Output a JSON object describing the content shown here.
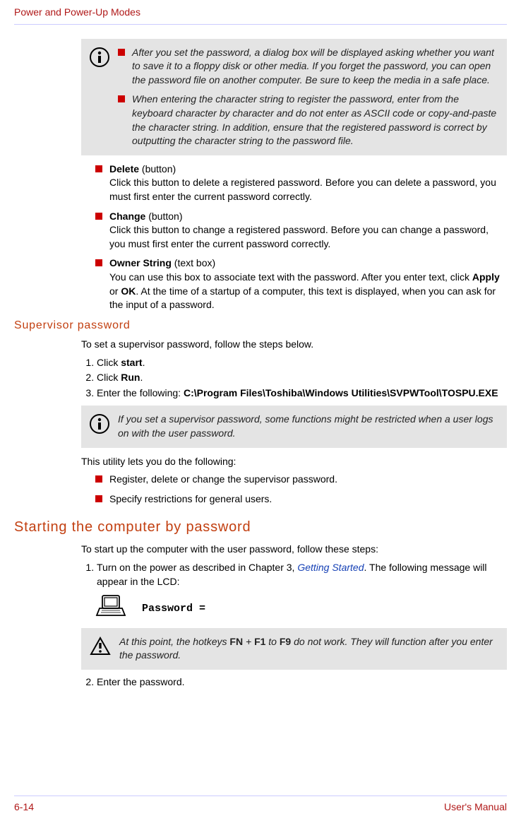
{
  "header": {
    "title": "Power and Power-Up Modes"
  },
  "info1": {
    "item1": "After you set the password, a dialog box will be displayed asking whether you want to save it to a floppy disk or other media. If you forget the password, you can open the password file on another computer. Be sure to keep the media in a safe place.",
    "item2": "When entering the character string to register the password, enter from the keyboard character by character and do not enter as ASCII code or copy-and-paste the character string. In addition, ensure that the registered password is correct by outputting the character string to the password file."
  },
  "bullets": {
    "delete": {
      "title": "Delete",
      "suffix": " (button)",
      "text": "Click this button to delete a registered password. Before you can delete a password, you must first enter the current password correctly."
    },
    "change": {
      "title": "Change",
      "suffix": " (button)",
      "text": "Click this button to change a registered password. Before you can change a password, you must first enter the current password correctly."
    },
    "owner": {
      "title": "Owner String",
      "suffix": " (text box)",
      "text_a": "You can use this box to associate text with the password. After you enter text, click ",
      "apply": "Apply",
      "or": " or ",
      "ok": "OK",
      "text_b": ". At the time of a startup of a computer, this text is displayed, when you can ask for the input of a password."
    }
  },
  "sup": {
    "heading": "Supervisor password",
    "intro": "To set a supervisor password, follow the steps below.",
    "step1a": "Click ",
    "step1b": "start",
    "step1c": ".",
    "step2a": "Click ",
    "step2b": "Run",
    "step2c": ".",
    "step3a": "Enter the following: ",
    "step3b": "C:\\Program Files\\Toshiba\\Windows Utilities\\SVPWTool\\TOSPU.EXE"
  },
  "info2": {
    "text": "If you set a supervisor password, some functions might be restricted when a user logs on with the user password."
  },
  "postinfo": {
    "intro": "This utility lets you do the following:",
    "b1": "Register, delete or change the supervisor password.",
    "b2": "Specify restrictions for general users."
  },
  "start": {
    "heading": "Starting the computer by password",
    "intro": "To start up the computer with the user password, follow these steps:",
    "step1a": "Turn on the power as described in Chapter 3, ",
    "step1link": "Getting Started",
    "step1b": ". The following message will appear in the LCD:",
    "password_label": "Password ="
  },
  "caution": {
    "a": "At this point, the hotkeys ",
    "fn": "FN",
    "plus": " + ",
    "f1": "F1",
    "to": " to ",
    "f9": "F9",
    "b": " do not work. They will function after you enter the password."
  },
  "step2": "Enter the password.",
  "footer": {
    "page": "6-14",
    "manual": "User's Manual"
  }
}
